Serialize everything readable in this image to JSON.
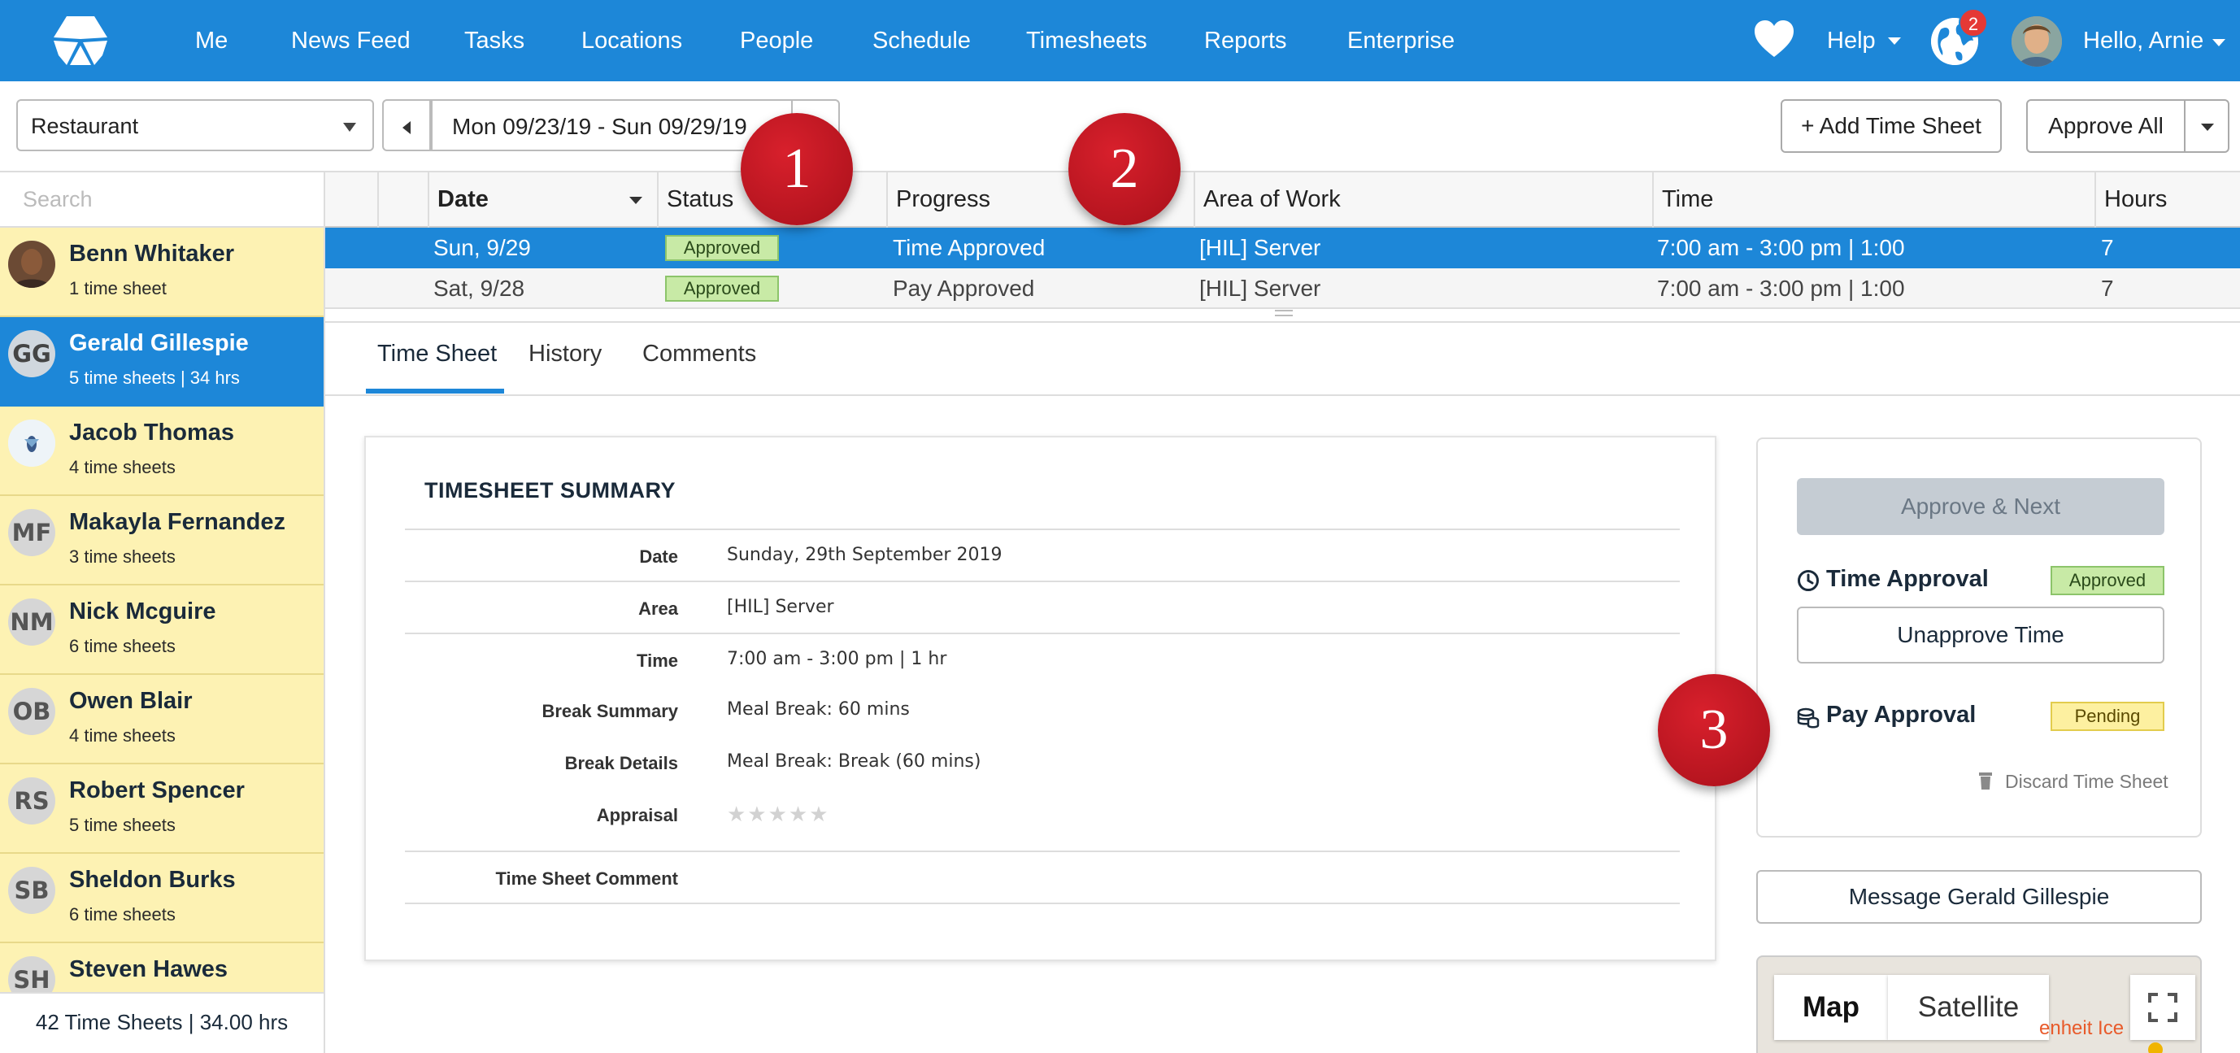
{
  "nav": {
    "items": [
      "Me",
      "News Feed",
      "Tasks",
      "Locations",
      "People",
      "Schedule",
      "Timesheets",
      "Reports",
      "Enterprise"
    ],
    "help_label": "Help",
    "notification_count": "2",
    "greeting": "Hello, Arnie",
    "brand_color": "#1d87d8"
  },
  "toolbar": {
    "location": "Restaurant",
    "date_range": "Mon 09/23/19 - Sun 09/29/19",
    "add_time_sheet": "+ Add Time Sheet",
    "approve_all": "Approve All"
  },
  "sidebar": {
    "search_placeholder": "Search",
    "people": [
      {
        "name": "Benn Whitaker",
        "sub": "1 time sheet",
        "initials": "",
        "avatar": "photo"
      },
      {
        "name": "Gerald Gillespie",
        "sub": "5 time sheets | 34 hrs",
        "initials": "GG",
        "selected": true
      },
      {
        "name": "Jacob Thomas",
        "sub": "4 time sheets",
        "initials": "",
        "avatar": "image"
      },
      {
        "name": "Makayla Fernandez",
        "sub": "3 time sheets",
        "initials": "MF"
      },
      {
        "name": "Nick Mcguire",
        "sub": "6 time sheets",
        "initials": "NM"
      },
      {
        "name": "Owen Blair",
        "sub": "4 time sheets",
        "initials": "OB"
      },
      {
        "name": "Robert Spencer",
        "sub": "5 time sheets",
        "initials": "RS"
      },
      {
        "name": "Sheldon Burks",
        "sub": "6 time sheets",
        "initials": "SB"
      },
      {
        "name": "Steven Hawes",
        "sub": "",
        "initials": "SH"
      }
    ],
    "footer": "42 Time Sheets | 34.00 hrs"
  },
  "table": {
    "headers": {
      "date": "Date",
      "status": "Status",
      "progress": "Progress",
      "area": "Area of Work",
      "time": "Time",
      "hours": "Hours"
    },
    "rows": [
      {
        "date": "Sun, 9/29",
        "status": "Approved",
        "progress": "Time Approved",
        "area": "[HIL] Server",
        "time": "7:00 am - 3:00 pm | 1:00",
        "hours": "7"
      },
      {
        "date": "Sat, 9/28",
        "status": "Approved",
        "progress": "Pay Approved",
        "area": "[HIL] Server",
        "time": "7:00 am - 3:00 pm | 1:00",
        "hours": "7"
      }
    ]
  },
  "tabs": [
    "Time Sheet",
    "History",
    "Comments"
  ],
  "summary": {
    "title": "TIMESHEET SUMMARY",
    "rows": [
      {
        "label": "Date",
        "value": "Sunday, 29th September 2019"
      },
      {
        "label": "Area",
        "value": "[HIL] Server"
      },
      {
        "label": "Time",
        "value": "7:00 am - 3:00 pm | 1 hr"
      },
      {
        "label": "Break Summary",
        "value": "Meal Break: 60 mins"
      },
      {
        "label": "Break Details",
        "value": "Meal Break: Break (60 mins)"
      },
      {
        "label": "Appraisal",
        "value": ""
      },
      {
        "label": "Time Sheet Comment",
        "value": ""
      }
    ],
    "appraisal_stars": "★★★★★",
    "appraisal_rating": 0
  },
  "approval": {
    "approve_next": "Approve & Next",
    "time_approval_label": "Time Approval",
    "time_status": "Approved",
    "unapprove_time": "Unapprove Time",
    "pay_approval_label": "Pay Approval",
    "pay_status": "Pending",
    "discard": "Discard Time Sheet",
    "message_button": "Message Gerald Gillespie"
  },
  "map": {
    "map_label": "Map",
    "satellite_label": "Satellite",
    "partial_text": "enheit Ice"
  },
  "callouts": [
    "1",
    "2",
    "3"
  ]
}
